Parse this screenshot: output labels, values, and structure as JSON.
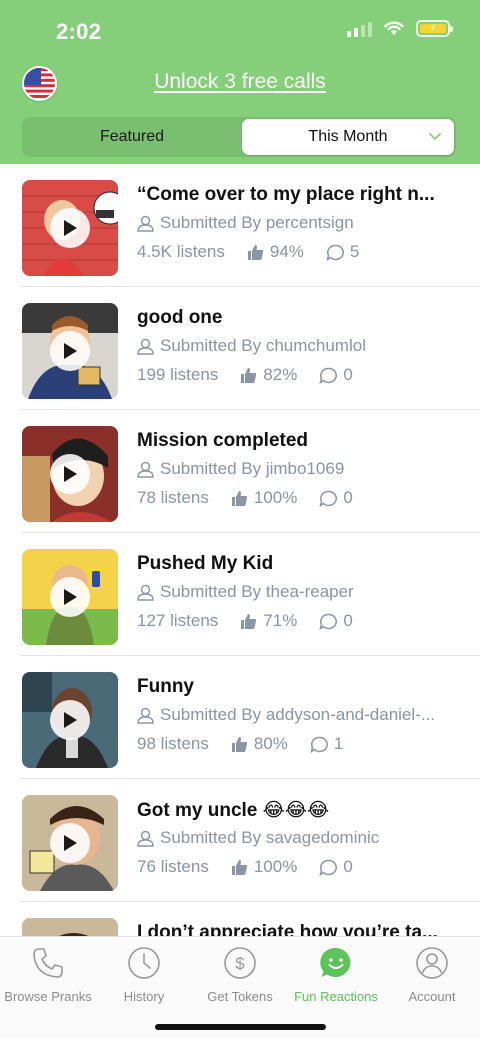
{
  "status": {
    "time": "2:02"
  },
  "header": {
    "unlock_label": "Unlock 3 free calls",
    "tabs": [
      {
        "label": "Featured",
        "selected": false
      },
      {
        "label": "This Month",
        "selected": true
      }
    ]
  },
  "items": [
    {
      "title": "“Come over to my place right n...",
      "submitter": "Submitted By percentsign",
      "listens": "4.5K listens",
      "likes": "94%",
      "comments": "5"
    },
    {
      "title": "good one",
      "submitter": "Submitted By chumchumlol",
      "listens": "199 listens",
      "likes": "82%",
      "comments": "0"
    },
    {
      "title": "Mission completed",
      "submitter": "Submitted By jimbo1069",
      "listens": "78 listens",
      "likes": "100%",
      "comments": "0"
    },
    {
      "title": "Pushed My Kid",
      "submitter": "Submitted By thea-reaper",
      "listens": "127 listens",
      "likes": "71%",
      "comments": "0"
    },
    {
      "title": "Funny",
      "submitter": "Submitted By addyson-and-daniel-...",
      "listens": "98 listens",
      "likes": "80%",
      "comments": "1"
    },
    {
      "title": "Got my uncle 😂😂😂",
      "submitter": "Submitted By savagedominic",
      "listens": "76 listens",
      "likes": "100%",
      "comments": "0"
    },
    {
      "title": "I don’t appreciate how you’re ta...",
      "submitter": "",
      "listens": "",
      "likes": "",
      "comments": ""
    }
  ],
  "tabbar": [
    {
      "label": "Browse Pranks",
      "icon": "phone-icon",
      "active": false
    },
    {
      "label": "History",
      "icon": "clock-icon",
      "active": false
    },
    {
      "label": "Get Tokens",
      "icon": "dollar-icon",
      "active": false
    },
    {
      "label": "Fun Reactions",
      "icon": "smile-chat-icon",
      "active": true
    },
    {
      "label": "Account",
      "icon": "user-icon",
      "active": false
    }
  ],
  "colors": {
    "header_bg": "#86cf7a",
    "accent": "#5cc35a",
    "muted_text": "#8a95a5"
  }
}
